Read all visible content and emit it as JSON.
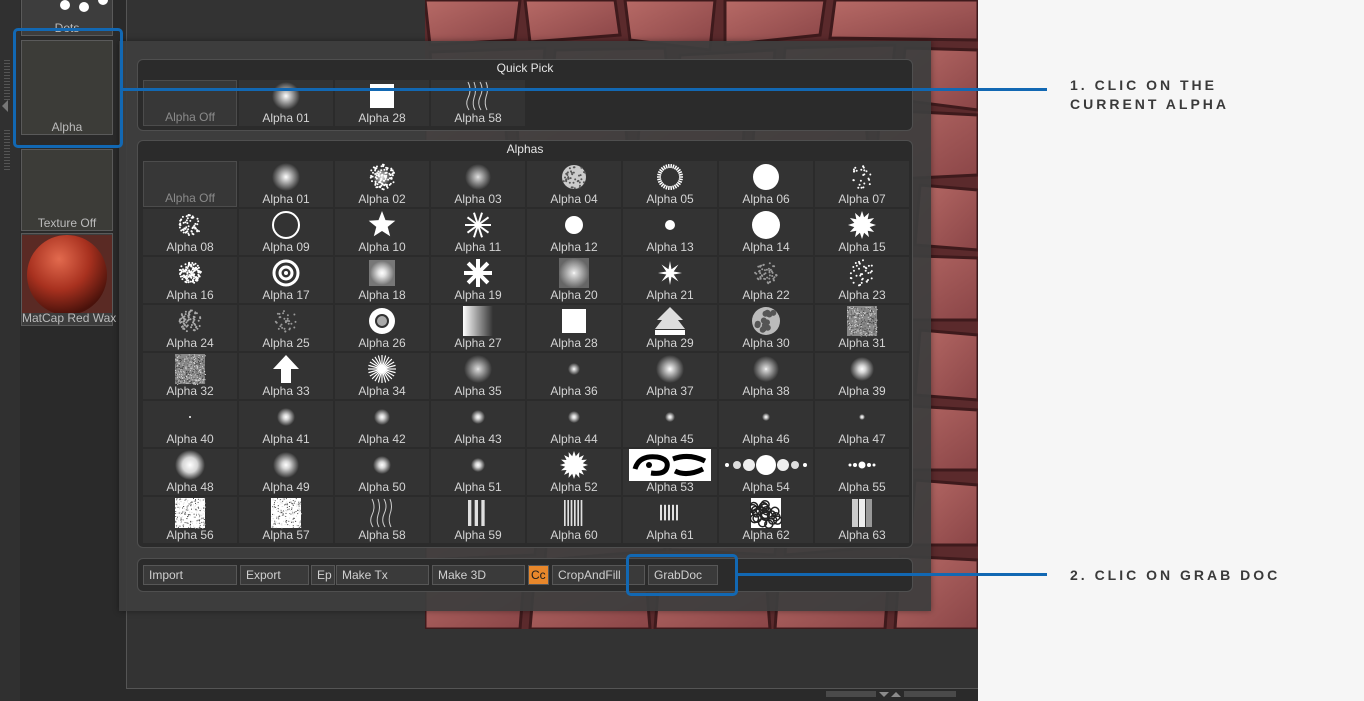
{
  "left_panel": {
    "top_thumb_label": "Dots",
    "alpha_thumb_label": "Alpha",
    "texture_thumb_label": "Texture Off",
    "material_thumb_label": "MatCap Red Wax"
  },
  "quick_pick": {
    "title": "Quick Pick",
    "items": [
      "Alpha Off",
      "Alpha 01",
      "Alpha 28",
      "Alpha 58"
    ]
  },
  "alphas": {
    "title": "Alphas",
    "items": [
      "Alpha Off",
      "Alpha 01",
      "Alpha 02",
      "Alpha 03",
      "Alpha 04",
      "Alpha 05",
      "Alpha 06",
      "Alpha 07",
      "Alpha 08",
      "Alpha 09",
      "Alpha 10",
      "Alpha 11",
      "Alpha 12",
      "Alpha 13",
      "Alpha 14",
      "Alpha 15",
      "Alpha 16",
      "Alpha 17",
      "Alpha 18",
      "Alpha 19",
      "Alpha 20",
      "Alpha 21",
      "Alpha 22",
      "Alpha 23",
      "Alpha 24",
      "Alpha 25",
      "Alpha 26",
      "Alpha 27",
      "Alpha 28",
      "Alpha 29",
      "Alpha 30",
      "Alpha 31",
      "Alpha 32",
      "Alpha 33",
      "Alpha 34",
      "Alpha 35",
      "Alpha 36",
      "Alpha 37",
      "Alpha 38",
      "Alpha 39",
      "Alpha 40",
      "Alpha 41",
      "Alpha 42",
      "Alpha 43",
      "Alpha 44",
      "Alpha 45",
      "Alpha 46",
      "Alpha 47",
      "Alpha 48",
      "Alpha 49",
      "Alpha 50",
      "Alpha 51",
      "Alpha 52",
      "Alpha 53",
      "Alpha 54",
      "Alpha 55",
      "Alpha 56",
      "Alpha 57",
      "Alpha 58",
      "Alpha 59",
      "Alpha 60",
      "Alpha 61",
      "Alpha 62",
      "Alpha 63"
    ]
  },
  "buttons": {
    "import": "Import",
    "export": "Export",
    "ep": "Ep",
    "make_tx": "Make Tx",
    "make_3d": "Make 3D",
    "cc": "Cc",
    "crop_and_fill": "CropAndFill",
    "grab_doc": "GrabDoc"
  },
  "annotations": {
    "step1_line1": "1. CLIC ON THE",
    "step1_line2": "CURRENT ALPHA",
    "step2": "2. CLIC ON GRAB DOC"
  },
  "colors": {
    "highlight": "#1268b3",
    "accent_orange": "#e8872b",
    "background": "#2a2a2a"
  }
}
